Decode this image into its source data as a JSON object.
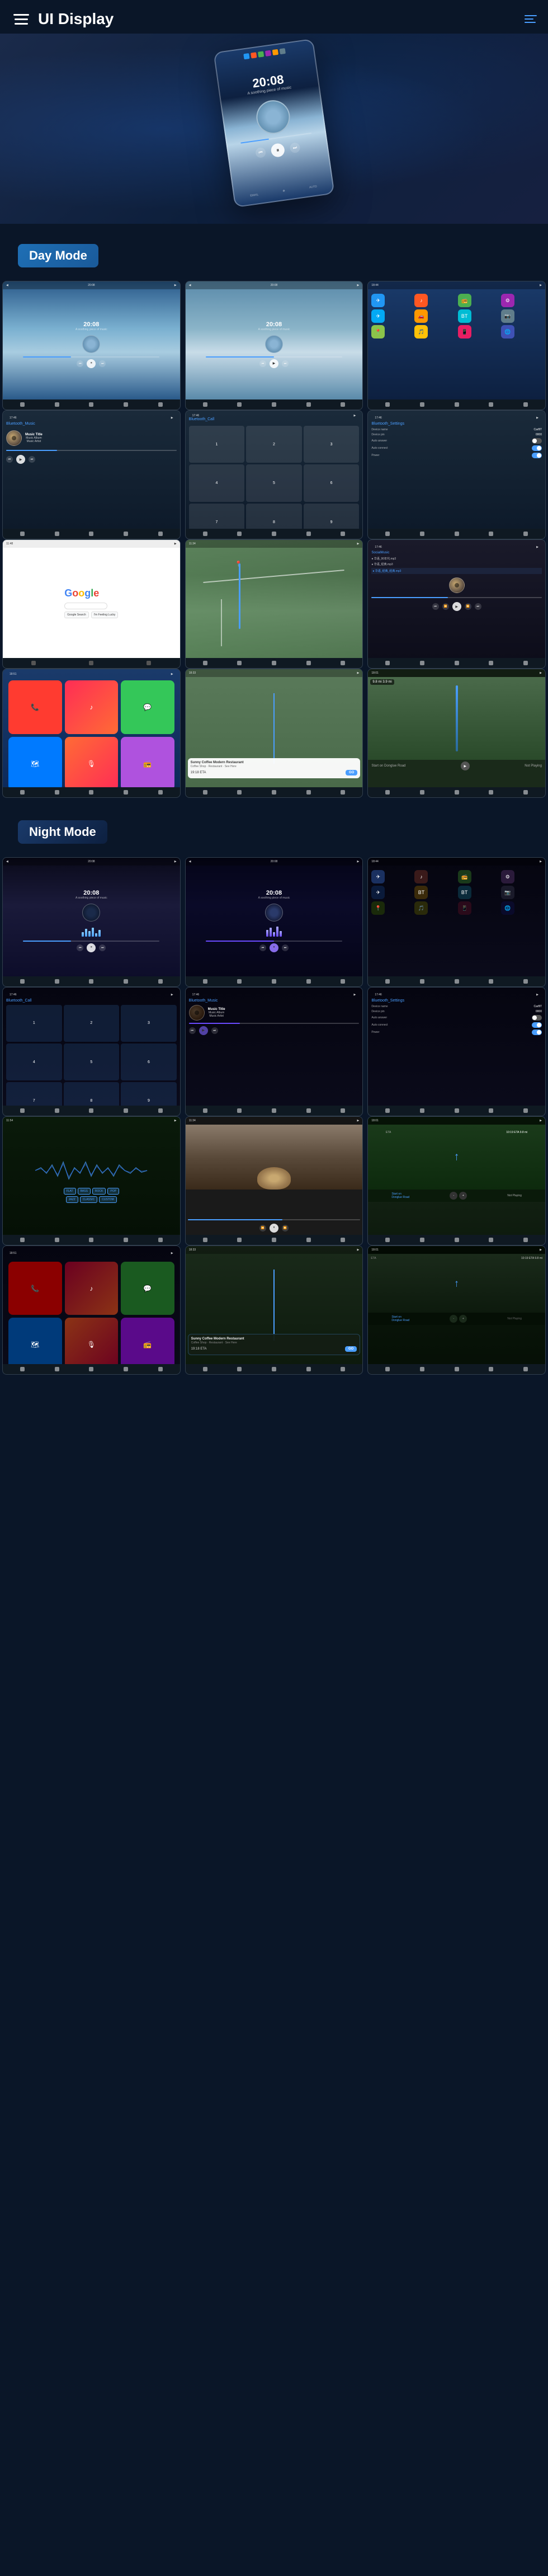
{
  "header": {
    "title": "UI Display",
    "menu_label": "menu",
    "nav_label": "navigation"
  },
  "day_mode": {
    "label": "Day Mode",
    "screens": [
      {
        "id": "day-music-1",
        "type": "music",
        "time": "20:08",
        "subtitle": "A soothing piece of music"
      },
      {
        "id": "day-music-2",
        "type": "music",
        "time": "20:08",
        "subtitle": "A soothing piece of music"
      },
      {
        "id": "day-apps",
        "type": "apps"
      },
      {
        "id": "day-bt-music",
        "type": "bt_music",
        "header": "Bluetooth_Music",
        "track": "Music Title",
        "album": "Music Album",
        "artist": "Music Artist"
      },
      {
        "id": "day-bt-call",
        "type": "bt_call",
        "header": "Bluetooth_Call"
      },
      {
        "id": "day-bt-settings",
        "type": "bt_settings",
        "header": "Bluetooth_Settings",
        "device_name": "CarBT",
        "device_pin": "0000"
      },
      {
        "id": "day-google",
        "type": "google"
      },
      {
        "id": "day-map-route",
        "type": "map_route"
      },
      {
        "id": "day-social-music",
        "type": "social_music"
      },
      {
        "id": "day-ios-apps",
        "type": "ios_apps"
      },
      {
        "id": "day-nav-card",
        "type": "nav_card",
        "restaurant": "Sunny Coffee Modern Restaurant"
      },
      {
        "id": "day-road-nav",
        "type": "road_nav",
        "distance": "9.8 mi",
        "eta": "19:18 ETA"
      }
    ]
  },
  "night_mode": {
    "label": "Night Mode",
    "screens": [
      {
        "id": "night-music-1",
        "type": "night_music",
        "time": "20:08",
        "subtitle": "A soothing piece of music"
      },
      {
        "id": "night-music-2",
        "type": "night_music",
        "time": "20:08",
        "subtitle": "A soothing piece of music"
      },
      {
        "id": "night-apps",
        "type": "night_apps"
      },
      {
        "id": "night-bt-call",
        "type": "night_bt_call",
        "header": "Bluetooth_Call"
      },
      {
        "id": "night-bt-music",
        "type": "night_bt_music",
        "header": "Bluetooth_Music",
        "track": "Music Title",
        "album": "Music Album",
        "artist": "Music Artist"
      },
      {
        "id": "night-bt-settings",
        "type": "night_bt_settings",
        "header": "Bluetooth_Settings"
      },
      {
        "id": "night-wave",
        "type": "wave"
      },
      {
        "id": "night-media",
        "type": "media"
      },
      {
        "id": "night-road",
        "type": "night_road"
      },
      {
        "id": "night-ios",
        "type": "night_ios"
      },
      {
        "id": "night-nav",
        "type": "night_nav",
        "restaurant": "Sunny Coffee Modern Restaurant"
      },
      {
        "id": "night-nav2",
        "type": "night_nav2"
      }
    ]
  },
  "colors": {
    "accent": "#4a9eff",
    "brand": "#1e6fb5",
    "bg_dark": "#0a1628",
    "day_label_bg": "#1e6fb5",
    "night_label_bg": "#1e3a6a"
  },
  "music_track": {
    "title": "Music Title",
    "album": "Music Album",
    "artist": "Music Artist"
  },
  "bluetooth_settings": {
    "device_name_label": "Device name",
    "device_name_value": "CarBT",
    "device_pin_label": "Device pin",
    "device_pin_value": "0000",
    "auto_answer_label": "Auto answer",
    "auto_connect_label": "Auto connect",
    "power_label": "Power"
  },
  "navigation": {
    "restaurant_name": "Sunny Coffee Modern Restaurant",
    "eta_day": "19:18 ETA",
    "distance_day": "9.8 mi 3.9 mi",
    "go_button": "GO",
    "distance_night": "10:19 ETA 9.8 mi"
  }
}
